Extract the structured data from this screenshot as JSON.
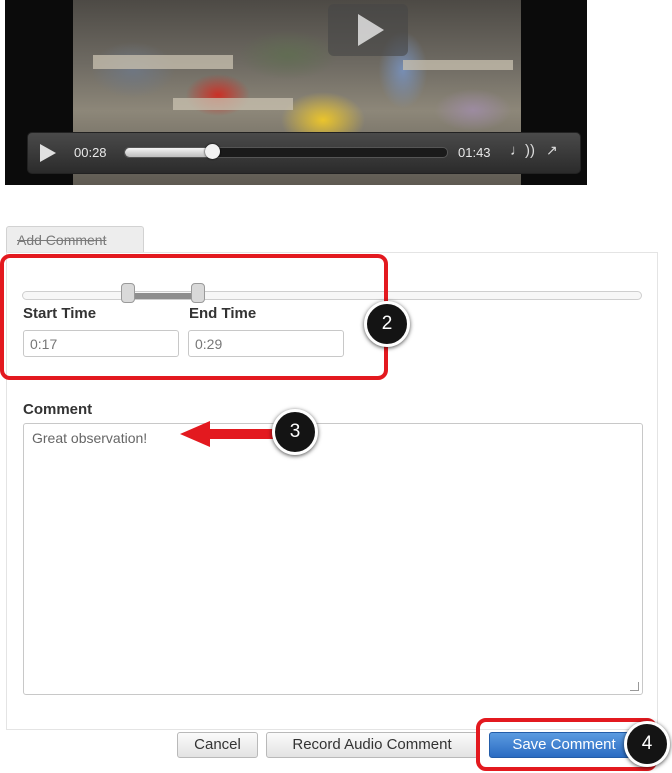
{
  "video": {
    "current_time": "00:28",
    "duration": "01:43",
    "progress": 0.27
  },
  "tab": {
    "label": "Add Comment"
  },
  "range": {
    "start_label": "Start Time",
    "end_label": "End Time",
    "start_value": "0:17",
    "end_value": "0:29"
  },
  "comment": {
    "label": "Comment",
    "value": "Great observation!"
  },
  "buttons": {
    "cancel": "Cancel",
    "record_audio": "Record Audio Comment",
    "save": "Save Comment"
  },
  "callouts": [
    "2",
    "3",
    "4"
  ],
  "colors": {
    "annotation_red": "#e3191f",
    "primary_button": "#2a6bc2"
  }
}
